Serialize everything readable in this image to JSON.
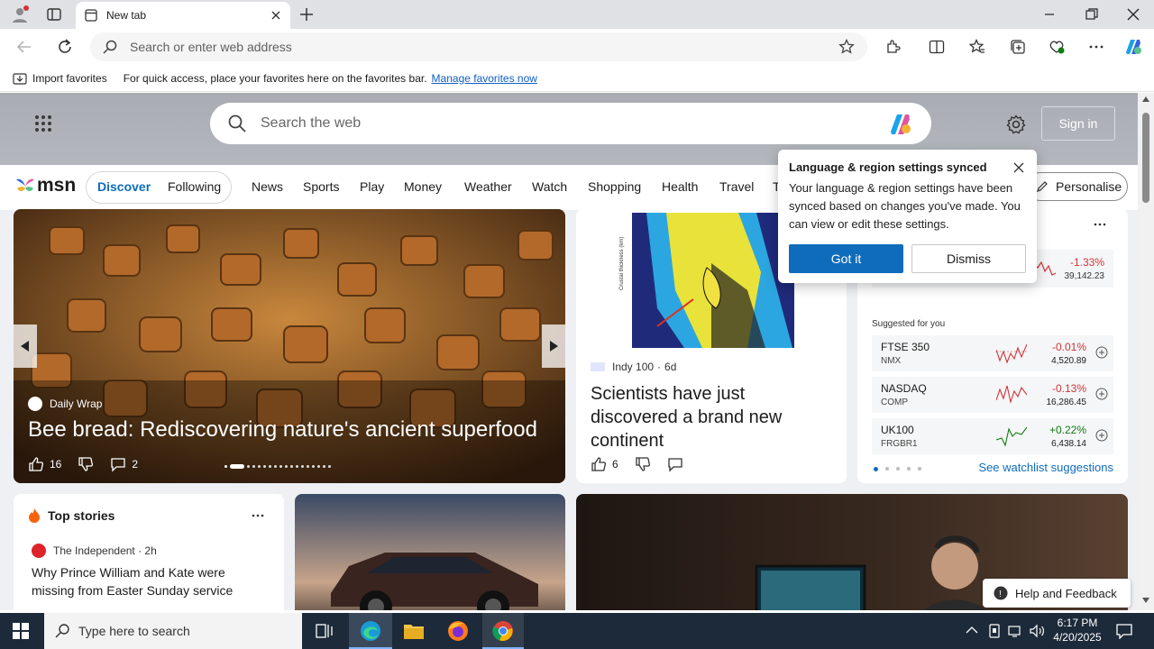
{
  "browser": {
    "tab_title": "New tab",
    "address_placeholder": "Search or enter web address",
    "favorites_import": "Import favorites",
    "favorites_hint": "For quick access, place your favorites here on the favorites bar.",
    "favorites_link": "Manage favorites now"
  },
  "msn": {
    "search_placeholder": "Search the web",
    "signin": "Sign in",
    "logo": "msn",
    "discover": "Discover",
    "following": "Following",
    "nav": [
      "News",
      "Sports",
      "Play",
      "Money",
      "Weather",
      "Watch",
      "Shopping",
      "Health",
      "Travel",
      "T"
    ],
    "personalise": "Personalise"
  },
  "hero": {
    "source": "Daily Wrap",
    "title": "Bee bread: Rediscovering nature's ancient superfood",
    "likes": "16",
    "comments": "2"
  },
  "story2": {
    "source": "Indy 100",
    "age": "6d",
    "title": "Scientists have just discovered a brand new continent",
    "likes": "6"
  },
  "popup": {
    "title": "Language & region settings synced",
    "body": "Your language & region settings have been synced based on changes you've made. You can view or edit these settings.",
    "got_it": "Got it",
    "dismiss": "Dismiss"
  },
  "watchlist": {
    "top_change": "-1.33%",
    "top_value": "39,142.23",
    "suggested": "Suggested for you",
    "items": [
      {
        "name": "FTSE 350",
        "code": "NMX",
        "change": "-0.01%",
        "value": "4,520.89"
      },
      {
        "name": "NASDAQ",
        "code": "COMP",
        "change": "-0.13%",
        "value": "16,286.45"
      },
      {
        "name": "UK100",
        "code": "FRGBR1",
        "change": "+0.22%",
        "value": "6,438.14"
      }
    ],
    "link": "See watchlist suggestions"
  },
  "topstories": {
    "header": "Top stories",
    "source": "The Independent · 2h",
    "title": "Why Prince William and Kate were missing from Easter Sunday service"
  },
  "feedback": "Help and Feedback",
  "taskbar": {
    "search_placeholder": "Type here to search",
    "time": "6:17 PM",
    "date": "4/20/2025"
  },
  "colors": {
    "accent": "#0f6cbd",
    "negative": "#d13438",
    "positive": "#107c10",
    "taskbar": "#1c2a3a"
  }
}
